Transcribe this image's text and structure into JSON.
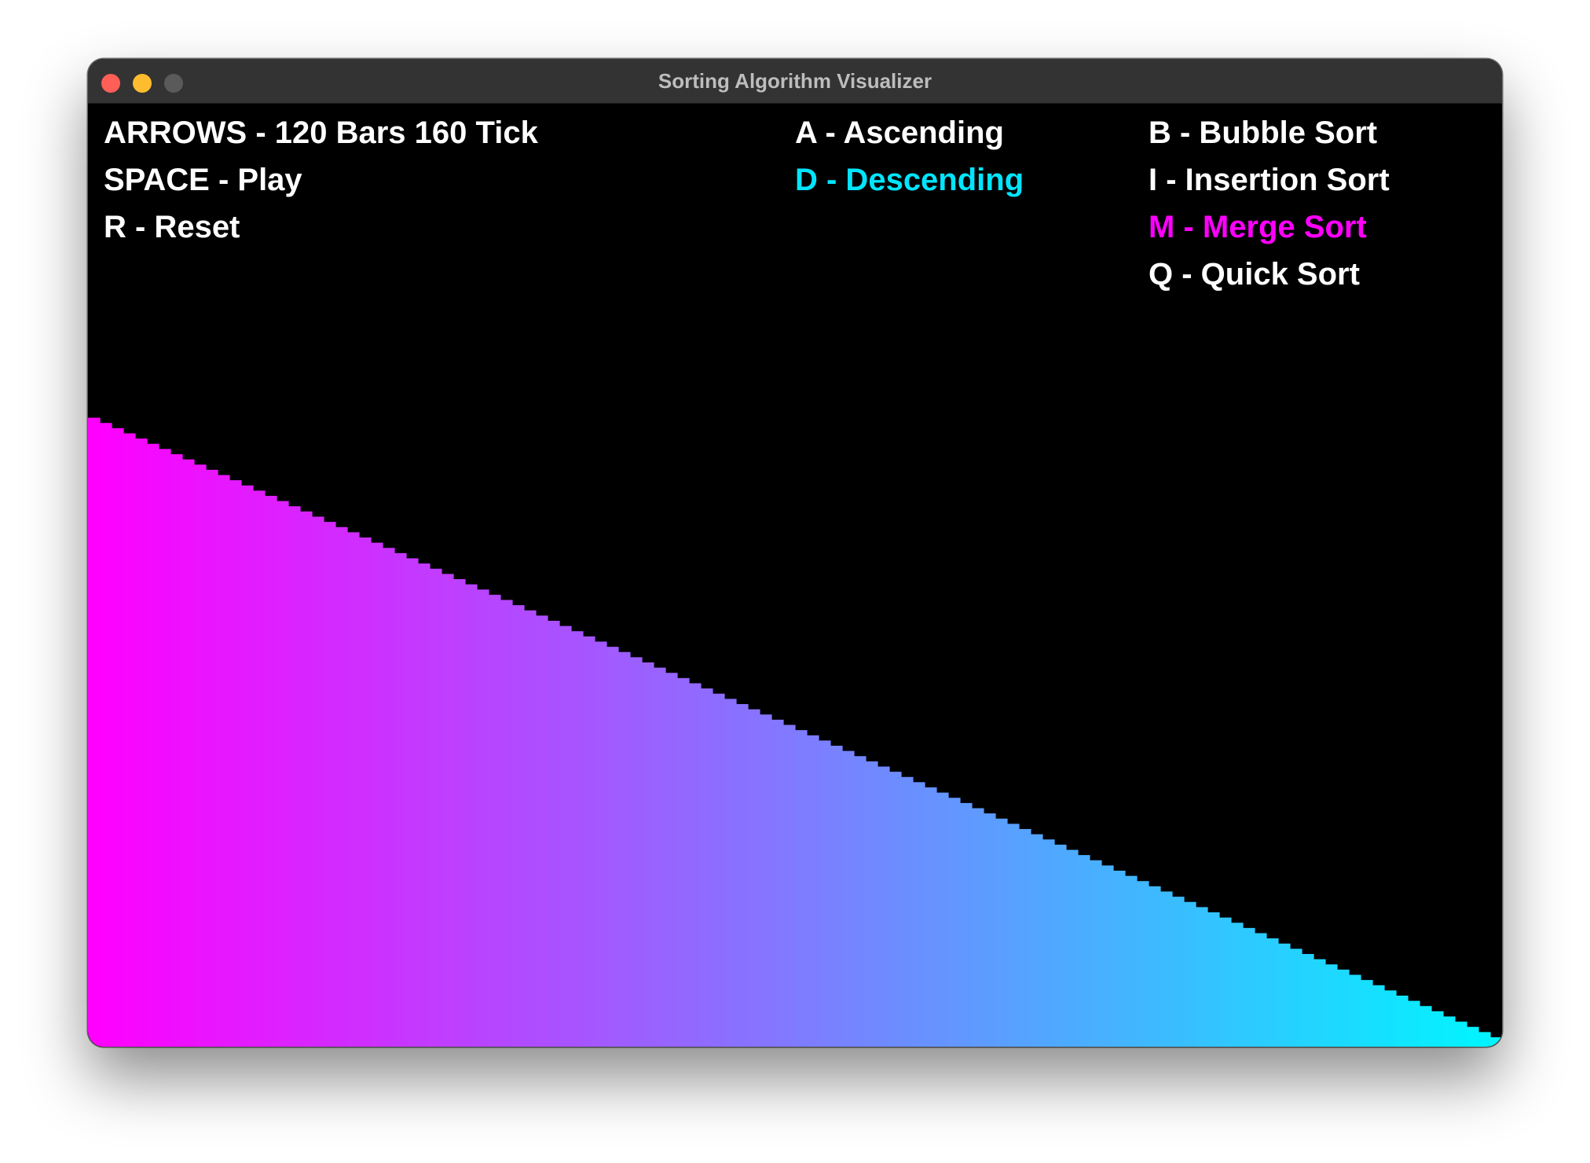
{
  "window": {
    "title": "Sorting Algorithm Visualizer"
  },
  "controls": {
    "arrows": "ARROWS - 120 Bars  160 Tick",
    "space": "SPACE - Play",
    "reset": "R - Reset",
    "ascending": "A - Ascending",
    "descending": "D - Descending",
    "bubble": "B - Bubble Sort",
    "insertion": "I - Insertion Sort",
    "merge": "M - Merge Sort",
    "quick": "Q - Quick Sort"
  },
  "state": {
    "order": "descending",
    "algorithm": "merge",
    "bar_count": 120,
    "tick": 160,
    "bar_height_start": 0.667,
    "bar_height_end": 0.01
  },
  "colors": {
    "default_text": "#ffffff",
    "selected_order": "#00e5ff",
    "selected_algorithm": "#ff00ff",
    "gradient_start": "#ff00ff",
    "gradient_end": "#00f5ff",
    "background": "#000000",
    "titlebar": "#333333",
    "title_text": "#bdbdbd",
    "close_button": "#ff5f57",
    "minimize_button": "#febc2e",
    "zoom_button": "#5a5a5a"
  }
}
